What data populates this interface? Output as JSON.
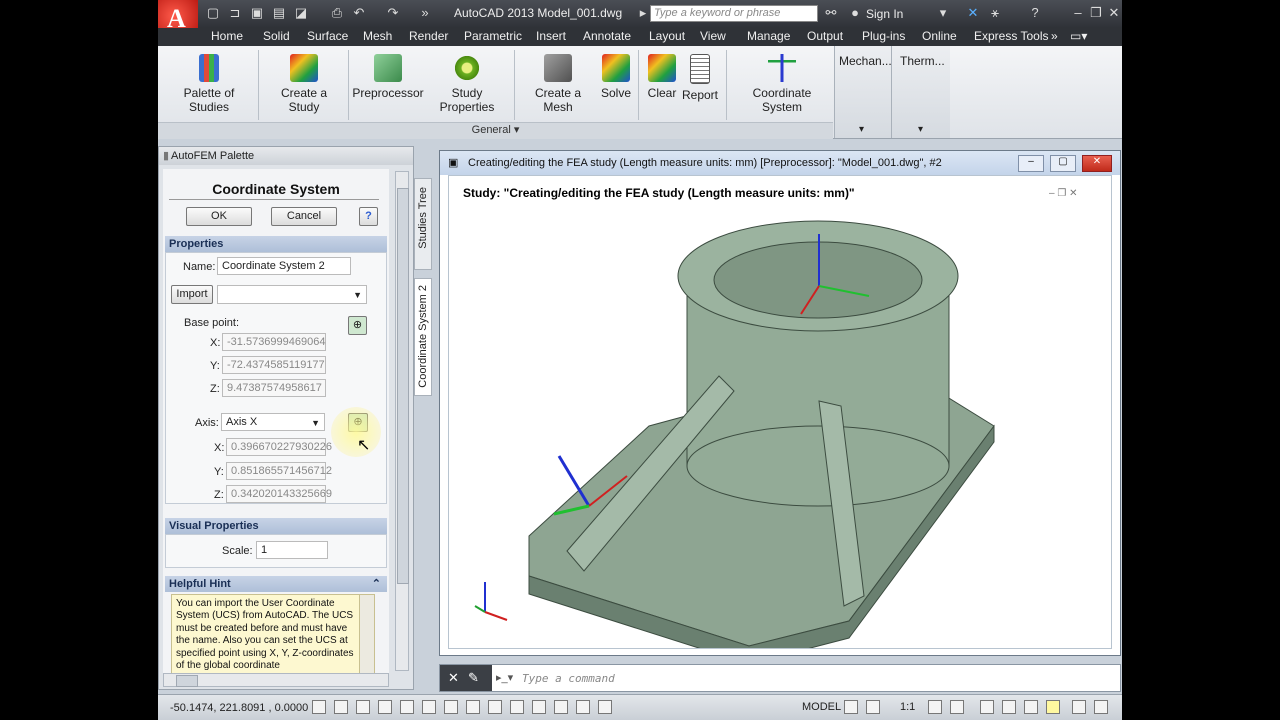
{
  "app": {
    "logo_letter": "A",
    "title": "AutoCAD 2013   Model_001.dwg",
    "search_placeholder": "Type a keyword or phrase",
    "sign_in": "Sign In"
  },
  "menu_tabs": [
    "Home",
    "Solid",
    "Surface",
    "Mesh",
    "Render",
    "Parametric",
    "Insert",
    "Annotate",
    "Layout",
    "View",
    "Manage",
    "Output",
    "Plug-ins",
    "Online",
    "Express Tools"
  ],
  "ribbon": {
    "buttons": [
      "Palette of Studies",
      "Create a Study",
      "Preprocessor",
      "Study Properties",
      "Create a Mesh",
      "Solve",
      "Clear",
      "Report",
      "Coordinate System"
    ],
    "panel_name": "General",
    "collapsed_panels": [
      "Mechan...",
      "Therm..."
    ]
  },
  "palette": {
    "title": "AutoFEM  Palette",
    "heading": "Coordinate System",
    "ok": "OK",
    "cancel": "Cancel",
    "properties_header": "Properties",
    "name_label": "Name:",
    "name_value": "Coordinate System 2",
    "import_button": "Import",
    "base_point_label": "Base point:",
    "x_label": "X:",
    "y_label": "Y:",
    "z_label": "Z:",
    "base_x": "-31.5736999469064",
    "base_y": "-72.4374585119177",
    "base_z": "9.47387574958617",
    "axis_label": "Axis:",
    "axis_value": "Axis X",
    "axis_x": "0.396670227930226",
    "axis_y": "0.851865571456712",
    "axis_z": "0.342020143325669",
    "visual_header": "Visual Properties",
    "scale_label": "Scale:",
    "scale_value": "1",
    "hint_header": "Helpful Hint",
    "hint_text": "You can import the User Coordinate System (UCS) from AutoCAD. The UCS must be created before and must have the name. Also you can set the UCS at specified point using X, Y, Z-coordinates of the global coordinate",
    "side_tabs": [
      "Studies Tree",
      "Coordinate System 2"
    ]
  },
  "viewport": {
    "title": "Creating/editing the FEA study  (Length measure units: mm) [Preprocessor]: \"Model_001.dwg\", #2",
    "study_label": "Study: \"Creating/editing the FEA study  (Length measure units: mm)\""
  },
  "command": {
    "placeholder": "Type a command"
  },
  "status": {
    "coords": "-50.1474, 221.8091 , 0.0000",
    "model": "MODEL",
    "scale": "1:1"
  }
}
